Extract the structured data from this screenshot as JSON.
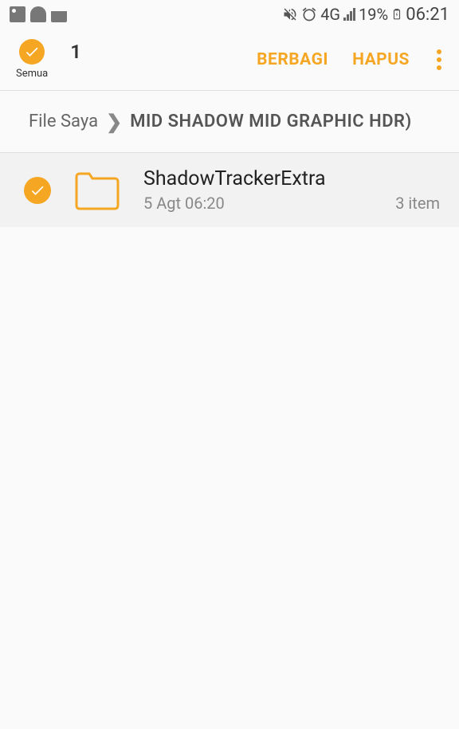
{
  "status": {
    "network_label": "4G",
    "battery_percent": "19%",
    "time": "06:21"
  },
  "toolbar": {
    "select_all_label": "Semua",
    "selection_count": "1",
    "share_label": "BERBAGI",
    "delete_label": "HAPUS"
  },
  "breadcrumb": {
    "root": "File Saya",
    "path": "MID SHADOW  MID GRAPHIC  HDR)"
  },
  "files": [
    {
      "name": "ShadowTrackerExtra",
      "date": "5 Agt 06:20",
      "count": "3 item",
      "selected": true
    }
  ]
}
